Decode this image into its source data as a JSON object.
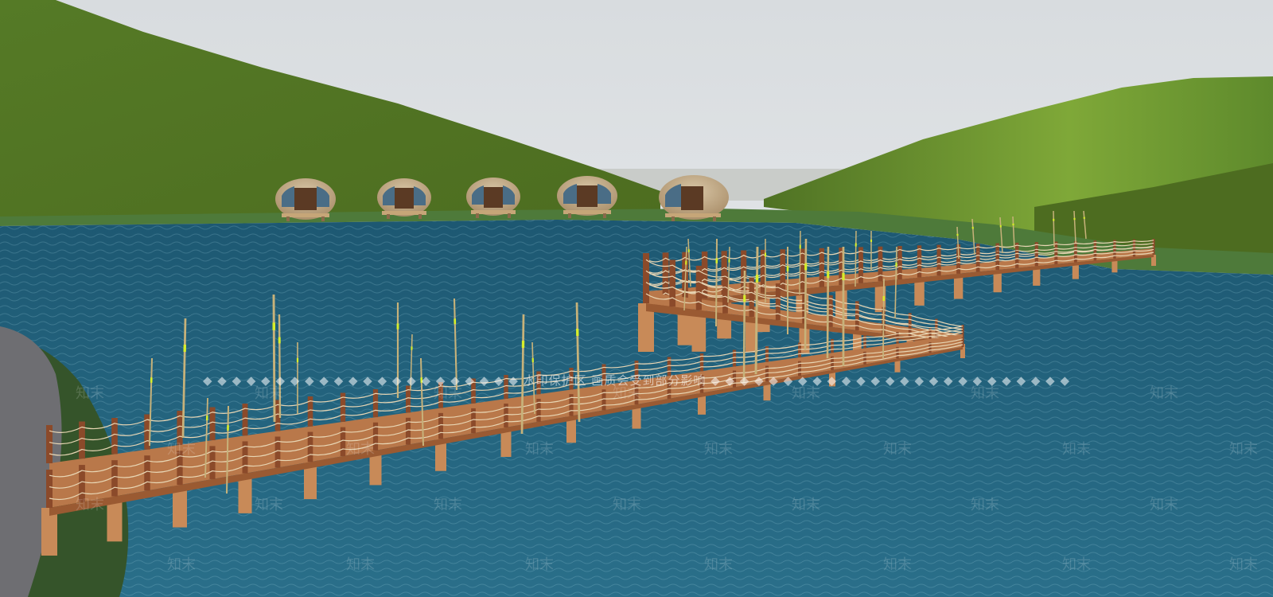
{
  "scene": {
    "sky_color": "#e4e7ea",
    "hill_color": "#5c7d2a",
    "water_color": "#1f5f78",
    "deck_color": "#b9784a",
    "post_color": "#8b4a2a",
    "reed_color": "#c7b27a",
    "reed_tip_color": "#d7ee2a",
    "path_color": "#6e6e72"
  },
  "watermark": {
    "banner_text": "◆ ◆ ◆ ◆ ◆ ◆ ◆ ◆ ◆ ◆ ◆ ◆ ◆ ◆ ◆ ◆ ◆ ◆ ◆ ◆ ◆ ◆ 水印保护区  画质会受到部分影响 ◆ ◆ ◆ ◆ ◆ ◆ ◆ ◆ ◆ ◆ ◆ ◆ ◆ ◆ ◆ ◆ ◆ ◆ ◆ ◆ ◆ ◆ ◆ ◆ ◆",
    "mark": "知末"
  }
}
